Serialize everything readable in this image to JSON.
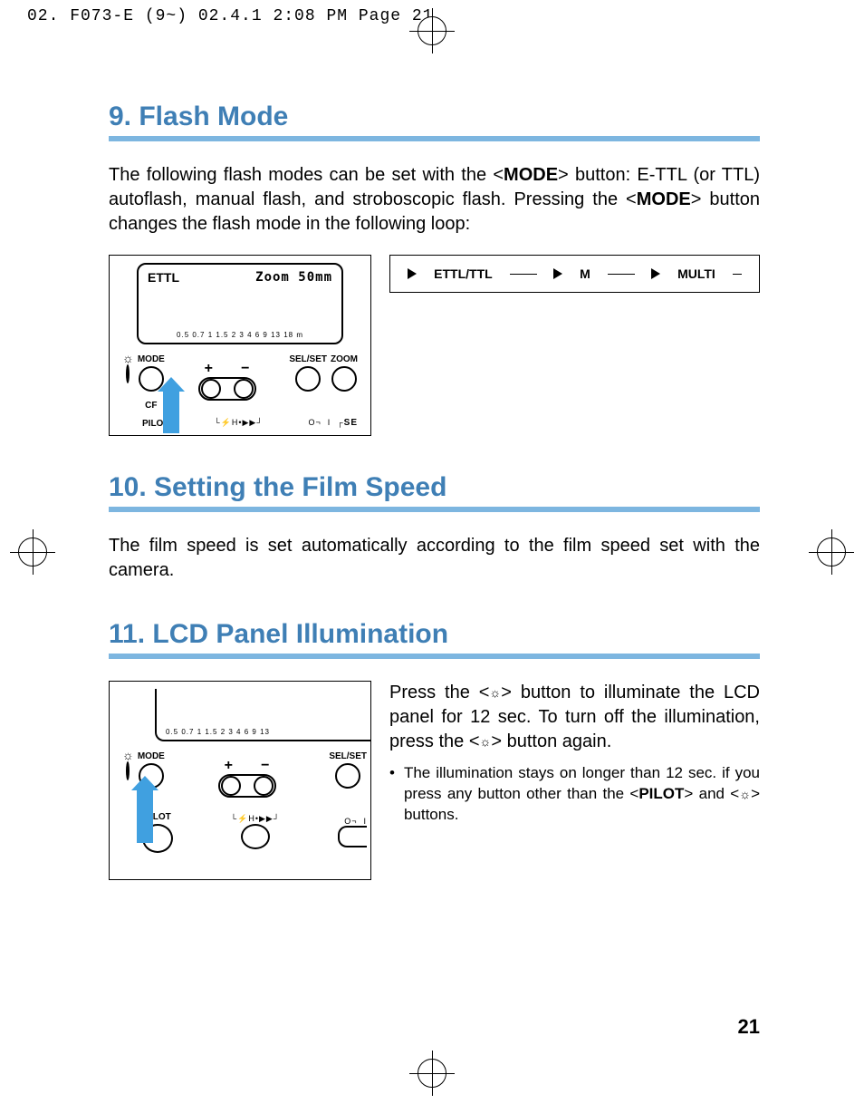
{
  "header": "02. F073-E (9~)  02.4.1 2:08 PM  Page 21",
  "section9": {
    "title": "9. Flash Mode",
    "para_a": "The following flash modes can be set with the <",
    "mode_label": "MODE",
    "para_b": "> button: E-TTL (or TTL) autoflash, manual flash, and stroboscopic flash. Pressing the <",
    "para_c": "> button changes the flash mode in the following loop:"
  },
  "lcd1": {
    "ettl": "ETTL",
    "zoom": "Zoom 50mm",
    "scale": "0.5 0.7  1  1.5  2   3   4   6   9  13 18  m",
    "mode": "MODE",
    "cf": "CF",
    "selset": "SEL/SET",
    "zoom_btn": "ZOOM",
    "pilot": "PILOT",
    "se": "SE"
  },
  "loop": {
    "a": "ETTL/TTL",
    "b": "M",
    "c": "MULTI"
  },
  "section10": {
    "title": "10. Setting the Film Speed",
    "para": "The film speed is set automatically according to the film speed set with the camera."
  },
  "section11": {
    "title": "11. LCD Panel Illumination",
    "para_a": "Press the <",
    "para_b": "> button to illuminate the LCD panel for 12 sec. To turn off the illumination, press the <",
    "para_c": "> button again.",
    "note_a": "The illumination stays on longer than 12 sec. if you press any button other than the <",
    "pilot": "PILOT",
    "note_b": "> and <",
    "note_c": "> buttons."
  },
  "lcd2": {
    "scale": "0.5 0.7  1  1.5  2   3   4   6   9  13",
    "mode": "MODE",
    "selset": "SEL/SET",
    "pilot": "PILOT"
  },
  "page_number": "21"
}
